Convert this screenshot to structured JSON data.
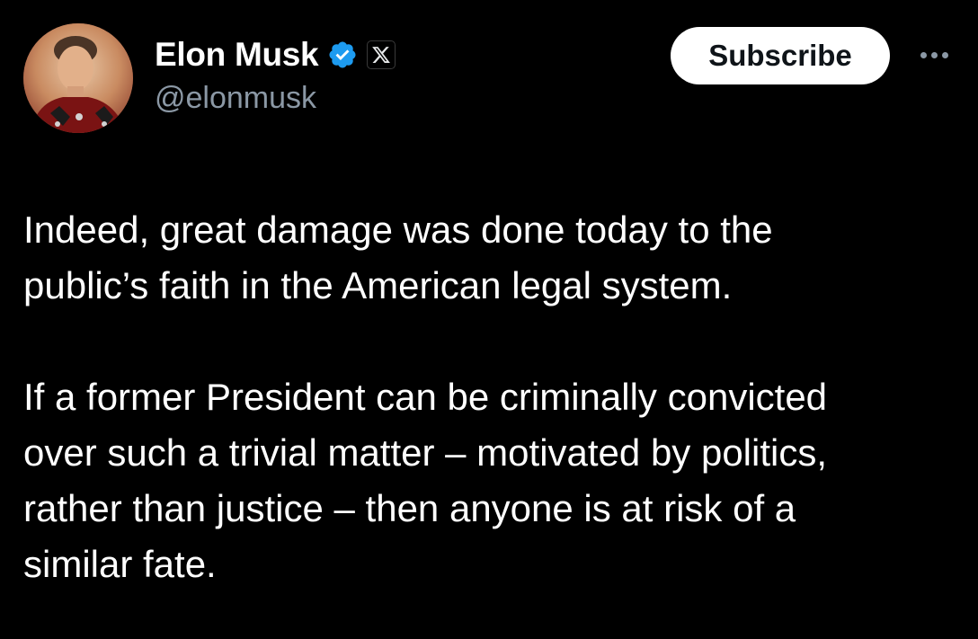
{
  "author": {
    "display_name": "Elon Musk",
    "handle": "@elonmusk",
    "verified_badge_color": "#1d9bf0",
    "affiliation_icon": "x-logo-icon"
  },
  "actions": {
    "subscribe_label": "Subscribe",
    "more_icon": "more-horizontal-icon"
  },
  "tweet": {
    "text": "Indeed, great damage was done today to the\npublic’s faith in the American legal system.\n\nIf a former President can be criminally convicted\nover such a trivial matter – motivated by politics,\nrather than justice – then anyone is at risk of a\nsimilar fate."
  },
  "colors": {
    "background": "#000000",
    "primary_text": "#ffffff",
    "secondary_text": "#8b98a5",
    "button_background": "#ffffff",
    "button_text": "#0f1419"
  }
}
